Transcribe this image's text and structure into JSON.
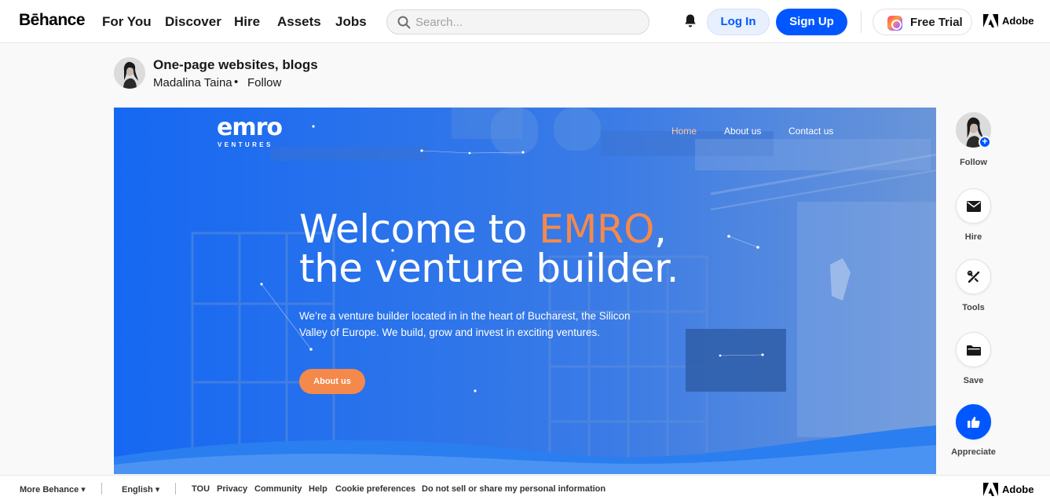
{
  "nav": {
    "logo": "Bēhance",
    "links": [
      "For You",
      "Discover",
      "Hire",
      "Assets",
      "Jobs"
    ],
    "search_placeholder": "Search...",
    "login": "Log In",
    "signup": "Sign Up",
    "free_trial": "Free Trial",
    "adobe": "Adobe"
  },
  "project": {
    "title": "One-page websites, blogs",
    "owner": "Madalina Taina",
    "separator": "•",
    "follow": "Follow"
  },
  "hero": {
    "logo_main": "emro",
    "logo_sub": "VENTURES",
    "nav": [
      "Home",
      "About us",
      "Contact us"
    ],
    "headline_pre": "Welcome to ",
    "headline_accent": "EMRO",
    "headline_post": ",",
    "headline_line2": "the venture builder.",
    "lead": "We’re a venture builder located in in the heart of Bucharest, the Silicon Valley of Europe. We build, grow and invest in exciting ventures.",
    "button": "About us"
  },
  "rail": {
    "follow": "Follow",
    "hire": "Hire",
    "tools": "Tools",
    "save": "Save",
    "appreciate": "Appreciate"
  },
  "footer": {
    "more": "More Behance ▾",
    "language": "English ▾",
    "links": [
      "TOU",
      "Privacy",
      "Community",
      "Help",
      "Cookie preferences",
      "Do not sell or share my personal information"
    ],
    "adobe": "Adobe"
  },
  "colors": {
    "brand_blue": "#0057ff",
    "hero_blue": "#1f6df0",
    "emro_orange": "#f5894b"
  }
}
